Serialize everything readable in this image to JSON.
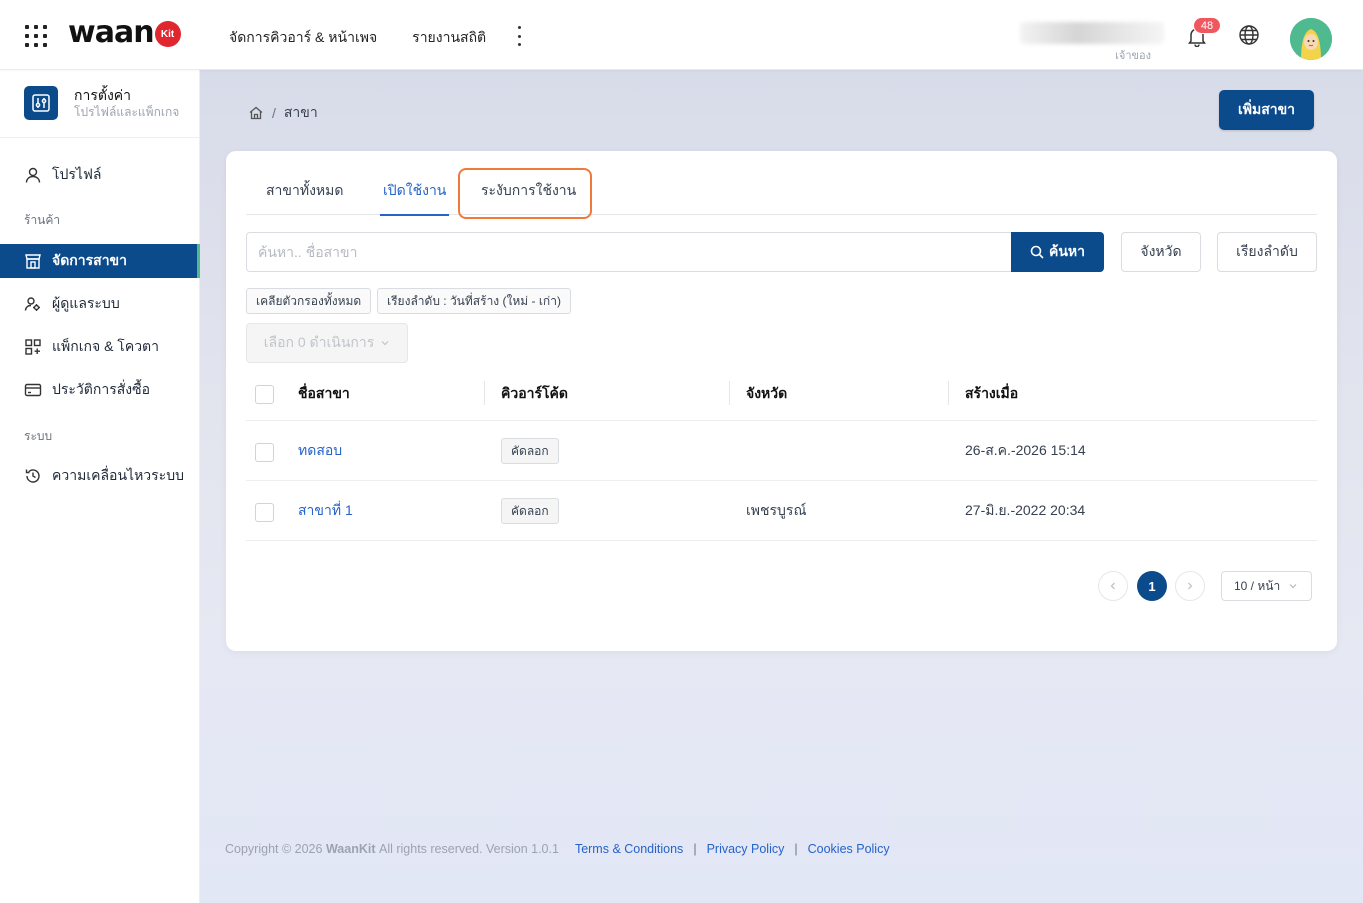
{
  "header": {
    "logo_text": "waan",
    "logo_badge": "Kit",
    "nav": [
      "จัดการคิวอาร์ & หน้าเพจ",
      "รายงานสถิติ"
    ],
    "user_role": "เจ้าของ",
    "notification_count": "48"
  },
  "sidebar": {
    "settings_title": "การตั้งค่า",
    "settings_subtitle": "โปรไฟล์และแพ็กเกจ",
    "profile_label": "โปรไฟล์",
    "group_store": "ร้านค้า",
    "manage_branch": "จัดการสาขา",
    "users_system": "ผู้ดูแลระบบ",
    "package_quota": "แพ็กเกจ & โควตา",
    "order_history": "ประวัติการสั่งซื้อ",
    "group_system": "ระบบ",
    "system_activity": "ความเคลื่อนไหวระบบ"
  },
  "breadcrumb": {
    "current": "สาขา"
  },
  "add_button": "เพิ่มสาขา",
  "tabs": {
    "all": "สาขาทั้งหมด",
    "active": "เปิดใช้งาน",
    "suspended": "ระงับการใช้งาน"
  },
  "search": {
    "placeholder": "ค้นหา.. ชื่อสาขา",
    "button": "ค้นหา",
    "province_button": "จังหวัด",
    "sort_button": "เรียงลำดับ"
  },
  "filters": {
    "clear_all": "เคลียตัวกรองทั้งหมด",
    "sort_chip": "เรียงลำดับ : วันที่สร้าง (ใหม่ - เก่า)"
  },
  "bulk_action": "เลือก 0 ดำเนินการ",
  "table": {
    "columns": [
      "ชื่อสาขา",
      "คิวอาร์โค้ด",
      "จังหวัด",
      "สร้างเมื่อ"
    ],
    "rows": [
      {
        "name": "ทดสอบ",
        "qr": "คัดลอก",
        "province": "",
        "created": "26-ส.ค.-2026 15:14"
      },
      {
        "name": "สาขาที่ 1",
        "qr": "คัดลอก",
        "province": "เพชรบูรณ์",
        "created": "27-มิ.ย.-2022 20:34"
      }
    ]
  },
  "pagination": {
    "current": "1",
    "page_size": "10 / หน้า"
  },
  "footer": {
    "copyright_prefix": "Copyright © 2026",
    "brand": "WaanKit",
    "copyright_suffix": "All rights reserved. Version 1.0.1",
    "links": [
      "Terms & Conditions",
      "Privacy Policy",
      "Cookies Policy"
    ]
  },
  "colors": {
    "primary": "#0b4a8b",
    "link": "#2563c9",
    "highlight": "#f07a3c",
    "badge": "#f0585f"
  }
}
